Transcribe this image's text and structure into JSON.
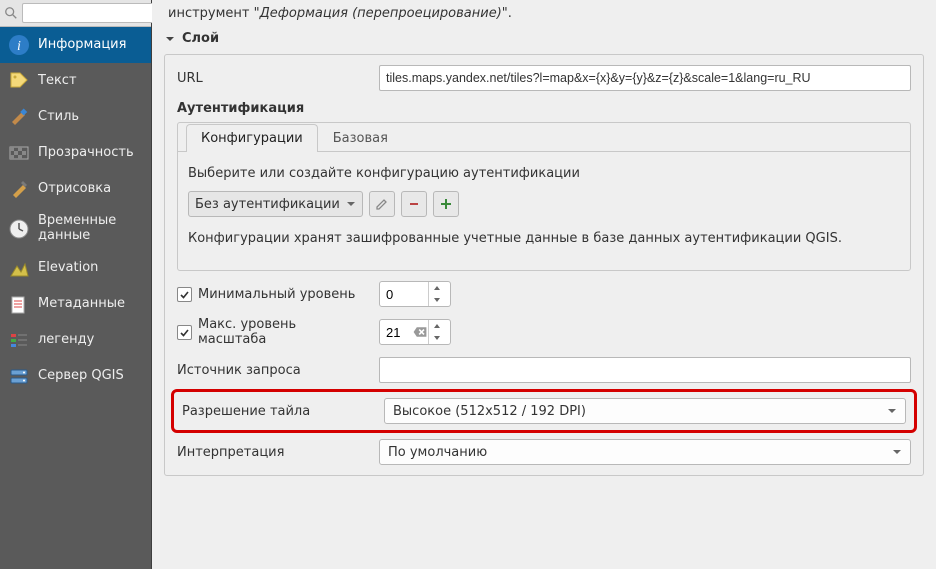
{
  "sidebar": {
    "items": [
      {
        "label": "Информация"
      },
      {
        "label": "Текст"
      },
      {
        "label": "Стиль"
      },
      {
        "label": "Прозрачность"
      },
      {
        "label": "Отрисовка"
      },
      {
        "label": "Временные данные"
      },
      {
        "label": "Elevation"
      },
      {
        "label": "Метаданные"
      },
      {
        "label": "легенду"
      },
      {
        "label": "Сервер QGIS"
      }
    ]
  },
  "main": {
    "top_note_prefix": "инструмент \"",
    "top_note_em": "Деформация (перепроецирование)",
    "top_note_suffix": "\".",
    "section_layer": "Слой",
    "url_label": "URL",
    "url_value": "tiles.maps.yandex.net/tiles?l=map&x={x}&y={y}&z={z}&scale=1&lang=ru_RU",
    "auth_label": "Аутентификация",
    "auth": {
      "tab_config": "Конфигурации",
      "tab_basic": "Базовая",
      "hint_select": "Выберите или создайте конфигурацию аутентификации",
      "combo_noauth": "Без аутентификации",
      "hint_store": "Конфигурации хранят зашифрованные учетные данные в базе данных аутентификации QGIS."
    },
    "min_zoom_label": "Минимальный уровень",
    "min_zoom_value": "0",
    "max_zoom_label": "Макс. уровень масштаба",
    "max_zoom_value": "21",
    "referer_label": "Источник запроса",
    "referer_value": "",
    "tile_res_label": "Разрешение тайла",
    "tile_res_value": "Высокое (512x512 / 192 DPI)",
    "interp_label": "Интерпретация",
    "interp_value": "По умолчанию"
  }
}
